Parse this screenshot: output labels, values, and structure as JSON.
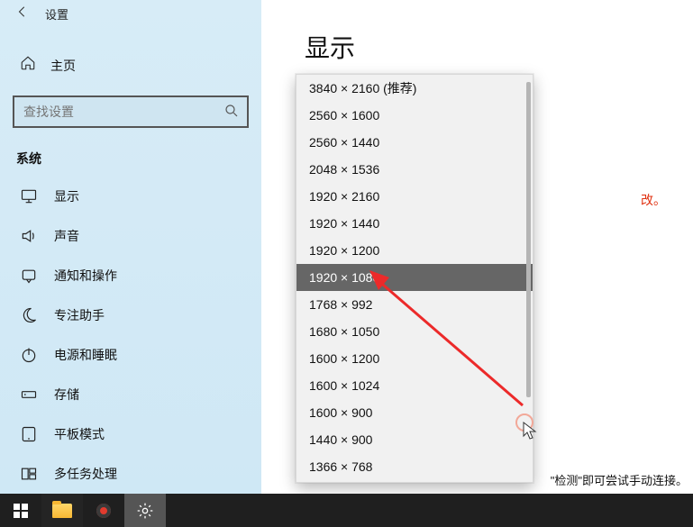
{
  "window": {
    "title": "设置"
  },
  "sidebar": {
    "home": "主页",
    "search_placeholder": "查找设置",
    "section": "系统",
    "items": [
      {
        "id": "display",
        "label": "显示",
        "icon": "monitor-icon"
      },
      {
        "id": "sound",
        "label": "声音",
        "icon": "speaker-icon"
      },
      {
        "id": "notify",
        "label": "通知和操作",
        "icon": "notification-icon"
      },
      {
        "id": "focus",
        "label": "专注助手",
        "icon": "moon-icon"
      },
      {
        "id": "power",
        "label": "电源和睡眠",
        "icon": "power-icon"
      },
      {
        "id": "storage",
        "label": "存储",
        "icon": "storage-icon"
      },
      {
        "id": "tablet",
        "label": "平板模式",
        "icon": "tablet-icon"
      },
      {
        "id": "multitask",
        "label": "多任务处理",
        "icon": "multitask-icon"
      }
    ]
  },
  "main": {
    "page_title": "显示",
    "red_fragment": "改。",
    "bottom_fragment": "\"检测\"即可尝试手动连接。"
  },
  "dropdown": {
    "selected_index": 7,
    "options": [
      "3840 × 2160 (推荐)",
      "2560 × 1600",
      "2560 × 1440",
      "2048 × 1536",
      "1920 × 2160",
      "1920 × 1440",
      "1920 × 1200",
      "1920 × 1080",
      "1768 × 992",
      "1680 × 1050",
      "1600 × 1200",
      "1600 × 1024",
      "1600 × 900",
      "1440 × 900",
      "1366 × 768"
    ]
  },
  "colors": {
    "accent": "#0078d4",
    "highlight": "#666666",
    "annotation": "#ec2a2a"
  }
}
